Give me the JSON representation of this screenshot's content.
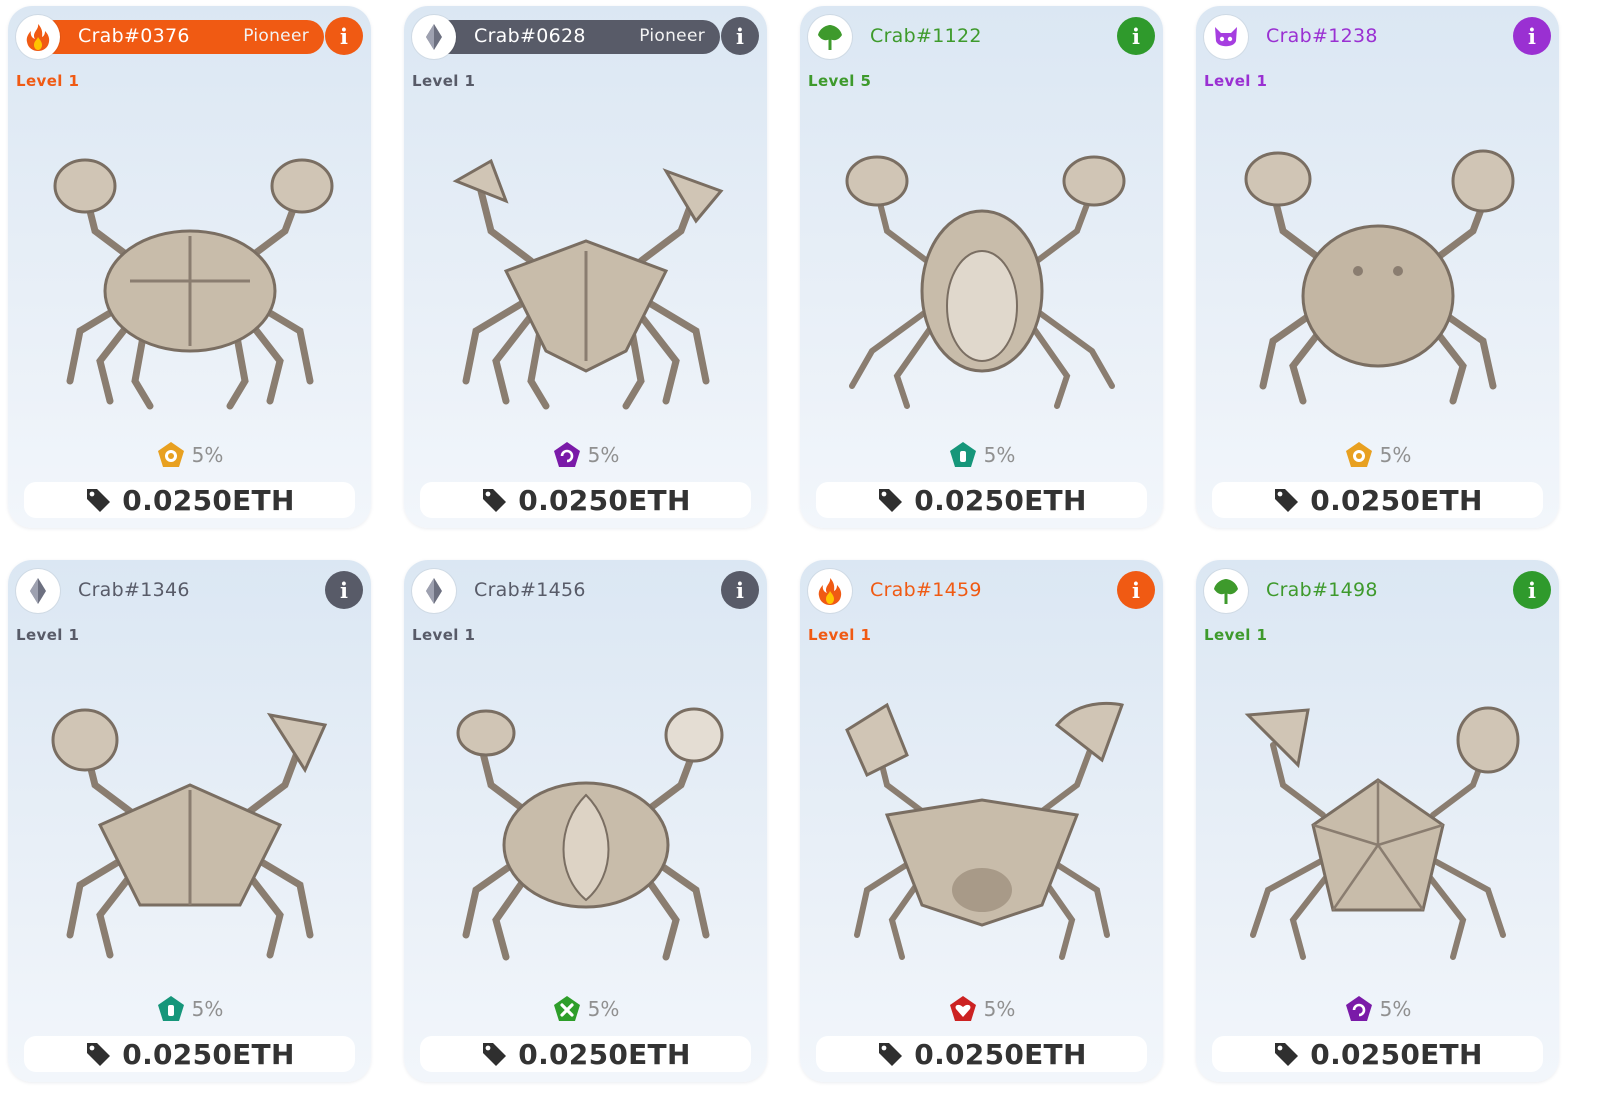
{
  "colors": {
    "fire": "#f05a13",
    "ghost": "#585b68",
    "nature": "#3e9a2c",
    "mystic": "#9a30d2",
    "water": "#16967a",
    "heart": "#cc2222",
    "orange": "#e8a020"
  },
  "cards": [
    {
      "name": "Crab#0376",
      "tag": "Pioneer",
      "level": "Level 1",
      "element_icon": "fire-icon",
      "bonus_icon": "orange-pentagon-flower-icon",
      "bonus": "5%",
      "price": "0.0250ETH"
    },
    {
      "name": "Crab#0628",
      "tag": "Pioneer",
      "level": "Level 1",
      "element_icon": "ghost-crystal-icon",
      "bonus_icon": "purple-pentagon-swirl-icon",
      "bonus": "5%",
      "price": "0.0250ETH"
    },
    {
      "name": "Crab#1122",
      "tag": "",
      "level": "Level 5",
      "element_icon": "nature-leaf-icon",
      "bonus_icon": "teal-pentagon-bottle-icon",
      "bonus": "5%",
      "price": "0.0250ETH"
    },
    {
      "name": "Crab#1238",
      "tag": "",
      "level": "Level 1",
      "element_icon": "mystic-demon-icon",
      "bonus_icon": "orange-pentagon-flower-icon",
      "bonus": "5%",
      "price": "0.0250ETH"
    },
    {
      "name": "Crab#1346",
      "tag": "",
      "level": "Level 1",
      "element_icon": "ghost-crystal-icon",
      "bonus_icon": "teal-pentagon-bottle-icon",
      "bonus": "5%",
      "price": "0.0250ETH"
    },
    {
      "name": "Crab#1456",
      "tag": "",
      "level": "Level 1",
      "element_icon": "ghost-crystal-icon",
      "bonus_icon": "green-pentagon-cross-icon",
      "bonus": "5%",
      "price": "0.0250ETH"
    },
    {
      "name": "Crab#1459",
      "tag": "",
      "level": "Level 1",
      "element_icon": "fire-icon",
      "bonus_icon": "red-pentagon-heart-icon",
      "bonus": "5%",
      "price": "0.0250ETH"
    },
    {
      "name": "Crab#1498",
      "tag": "",
      "level": "Level 1",
      "element_icon": "nature-leaf-icon",
      "bonus_icon": "purple-pentagon-swirl-icon",
      "bonus": "5%",
      "price": "0.0250ETH"
    }
  ],
  "info_glyph": "i"
}
